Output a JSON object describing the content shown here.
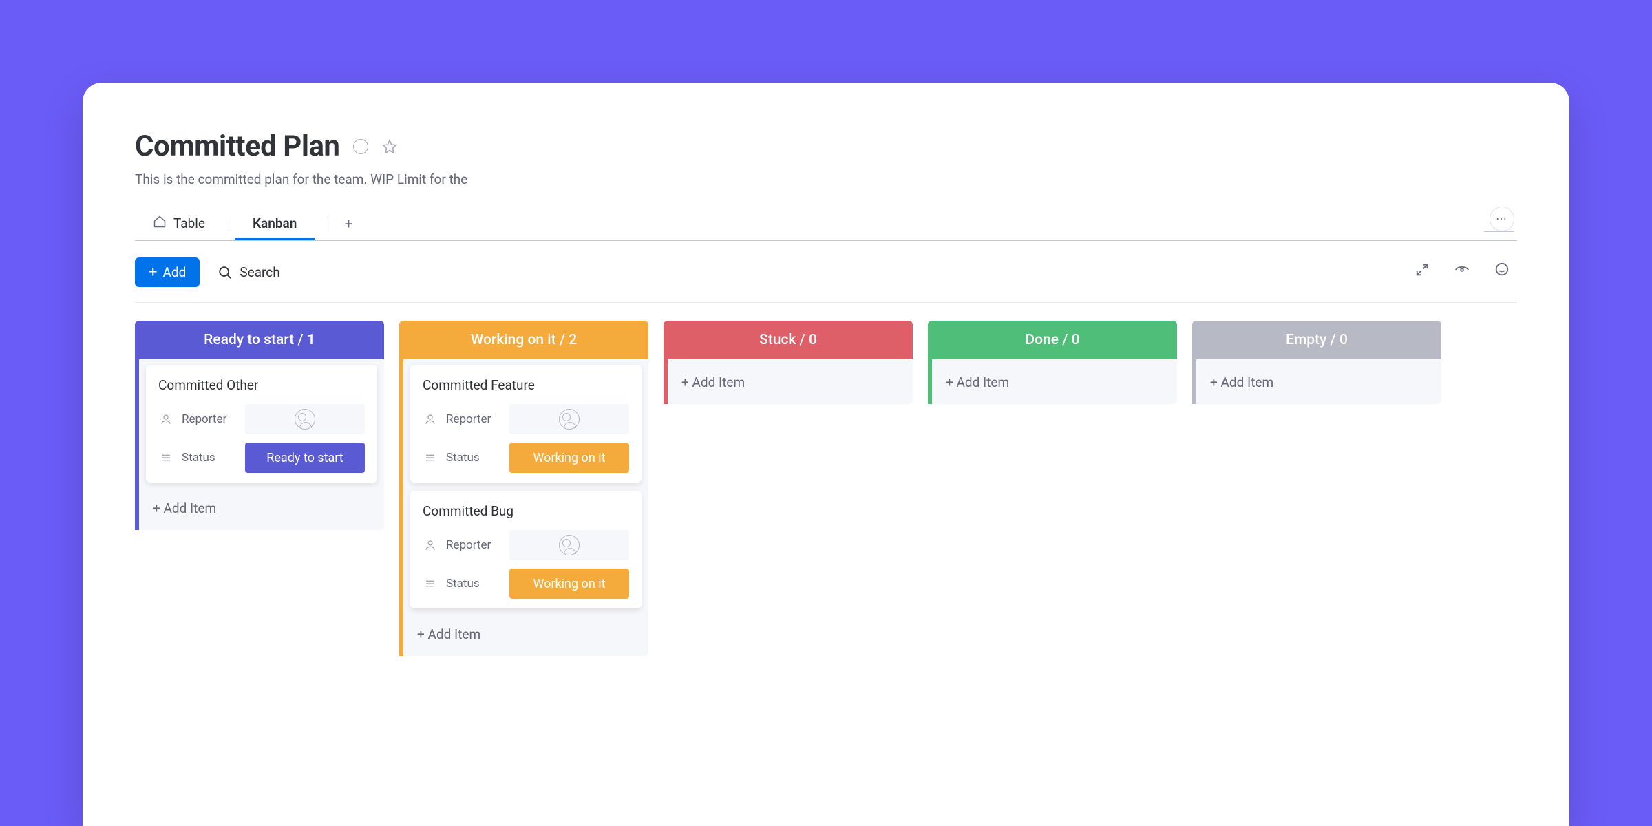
{
  "header": {
    "title": "Committed Plan",
    "info_icon": "i",
    "description": "This is the committed plan for the team. WIP Limit for the"
  },
  "tabs": {
    "table_label": "Table",
    "kanban_label": "Kanban",
    "add_tab": "+",
    "more": "⋯"
  },
  "toolbar": {
    "add_label": "Add",
    "search_label": "Search"
  },
  "labels": {
    "reporter": "Reporter",
    "status": "Status",
    "add_item": "+ Add Item"
  },
  "columns": [
    {
      "title": "Ready to start / 1",
      "color": "#595ad4",
      "stripe": "#595ad4",
      "cards": [
        {
          "title": "Committed Other",
          "status_label": "Ready to start",
          "status_color": "#595ad4"
        }
      ]
    },
    {
      "title": "Working on it / 2",
      "color": "#f5ab3c",
      "stripe": "#f5ab3c",
      "cards": [
        {
          "title": "Committed Feature",
          "status_label": "Working on it",
          "status_color": "#f5ab3c"
        },
        {
          "title": "Committed Bug",
          "status_label": "Working on it",
          "status_color": "#f5ab3c"
        }
      ]
    },
    {
      "title": "Stuck / 0",
      "color": "#df5f69",
      "stripe": "#df5f69",
      "cards": []
    },
    {
      "title": "Done / 0",
      "color": "#4fbe78",
      "stripe": "#4fbe78",
      "cards": []
    },
    {
      "title": "Empty / 0",
      "color": "#b7b9c4",
      "stripe": "#b7b9c4",
      "cards": []
    }
  ]
}
